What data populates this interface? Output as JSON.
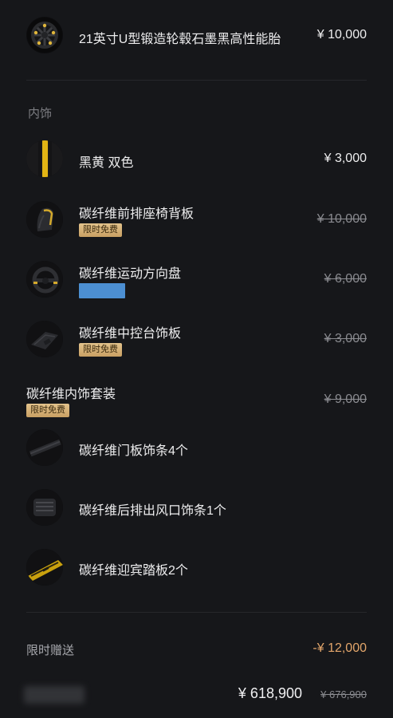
{
  "wheel": {
    "title": "21英寸U型锻造轮毂石墨黑高性能胎",
    "price": "¥ 10,000",
    "icon": "wheel-icon"
  },
  "interior": {
    "section_label": "内饰",
    "items": [
      {
        "title": "黑黄 双色",
        "price": "¥ 3,000",
        "icon": "color-swatch-icon"
      },
      {
        "title": "碳纤维前排座椅背板",
        "price": "¥ 10,000",
        "badge": "限时免费",
        "icon": "seat-back-icon"
      },
      {
        "title": "碳纤维运动方向盘",
        "price": "¥ 6,000",
        "icon": "steering-wheel-icon"
      },
      {
        "title": "碳纤维中控台饰板",
        "price": "¥ 3,000",
        "badge": "限时免费",
        "icon": "console-trim-icon"
      }
    ],
    "package": {
      "title": "碳纤维内饰套装",
      "price": "¥ 9,000",
      "badge": "限时免费",
      "sub_items": [
        {
          "title": "碳纤维门板饰条4个",
          "icon": "door-trim-icon"
        },
        {
          "title": "碳纤维后排出风口饰条1个",
          "icon": "air-vent-icon"
        },
        {
          "title": "碳纤维迎宾踏板2个",
          "icon": "sill-plate-icon"
        }
      ]
    }
  },
  "gift": {
    "label": "限时赠送",
    "value": "-¥ 12,000",
    "value_color": "#e3a66b"
  },
  "total": {
    "price": "¥ 618,900",
    "original_price": "¥ 676,900"
  },
  "colors": {
    "background": "#16171a",
    "accent_gold": "#d4b07a",
    "strike_gray": "#8a8b90"
  }
}
